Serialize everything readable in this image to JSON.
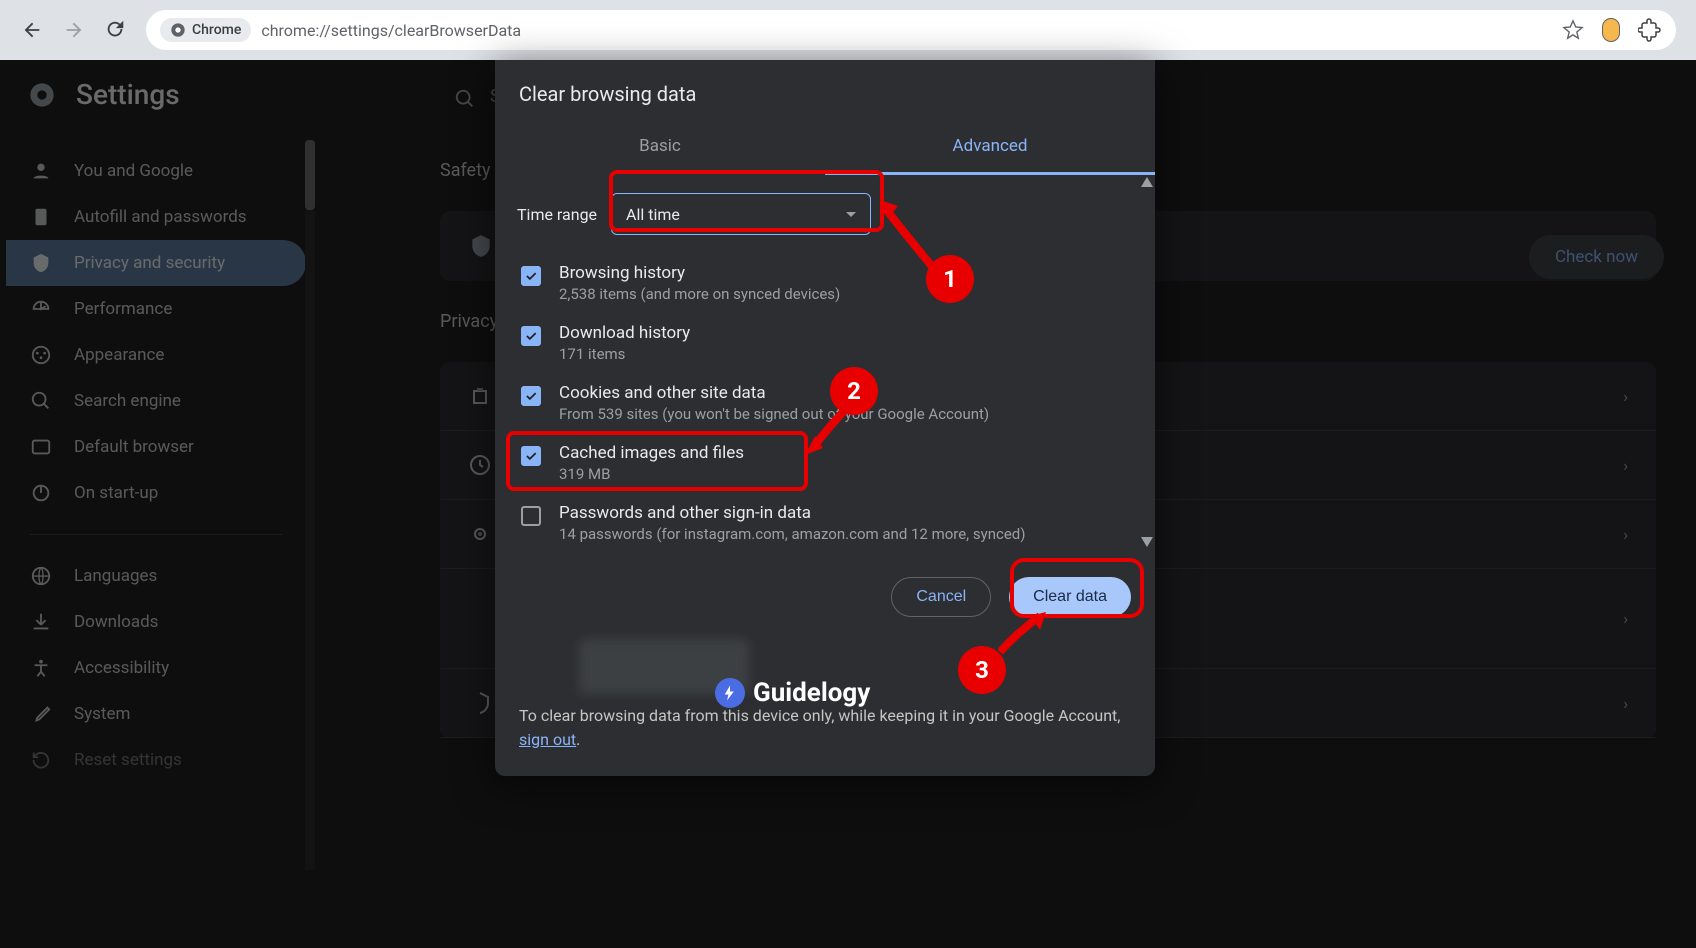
{
  "browser": {
    "chrome_chip": "Chrome",
    "url": "chrome://settings/clearBrowserData"
  },
  "settings": {
    "title": "Settings",
    "search_placeholder_visible": "Se",
    "sidebar": [
      {
        "label": "You and Google",
        "icon": "person"
      },
      {
        "label": "Autofill and passwords",
        "icon": "clipboard"
      },
      {
        "label": "Privacy and security",
        "icon": "shield",
        "active": true
      },
      {
        "label": "Performance",
        "icon": "speed"
      },
      {
        "label": "Appearance",
        "icon": "palette"
      },
      {
        "label": "Search engine",
        "icon": "search"
      },
      {
        "label": "Default browser",
        "icon": "browser"
      },
      {
        "label": "On start-up",
        "icon": "power"
      }
    ],
    "sidebar2": [
      {
        "label": "Languages",
        "icon": "globe"
      },
      {
        "label": "Downloads",
        "icon": "download"
      },
      {
        "label": "Accessibility",
        "icon": "accessibility"
      },
      {
        "label": "System",
        "icon": "wrench"
      },
      {
        "label": "Reset settings",
        "icon": "reset"
      }
    ]
  },
  "bg": {
    "safety_title": "Safety",
    "check_now": "Check now",
    "privacy_title": "Privacy"
  },
  "dialog": {
    "title": "Clear browsing data",
    "tabs": {
      "basic": "Basic",
      "advanced": "Advanced"
    },
    "time_range_label": "Time range",
    "time_range_value": "All time",
    "options": [
      {
        "title": "Browsing history",
        "sub": "2,538 items (and more on synced devices)",
        "checked": true
      },
      {
        "title": "Download history",
        "sub": "171 items",
        "checked": true
      },
      {
        "title": "Cookies and other site data",
        "sub": "From 539 sites (you won't be signed out of your Google Account)",
        "checked": true
      },
      {
        "title": "Cached images and files",
        "sub": "319 MB",
        "checked": true
      },
      {
        "title": "Passwords and other sign-in data",
        "sub": "14 passwords (for instagram.com, amazon.com and 12 more, synced)",
        "checked": false
      }
    ],
    "cancel": "Cancel",
    "clear": "Clear data",
    "note_prefix": "To clear browsing data from this device only, while keeping it in your Google Account, ",
    "note_link": "sign out",
    "note_suffix": "."
  },
  "annotations": {
    "n1": "1",
    "n2": "2",
    "n3": "3"
  },
  "watermark": "Guidelogy"
}
